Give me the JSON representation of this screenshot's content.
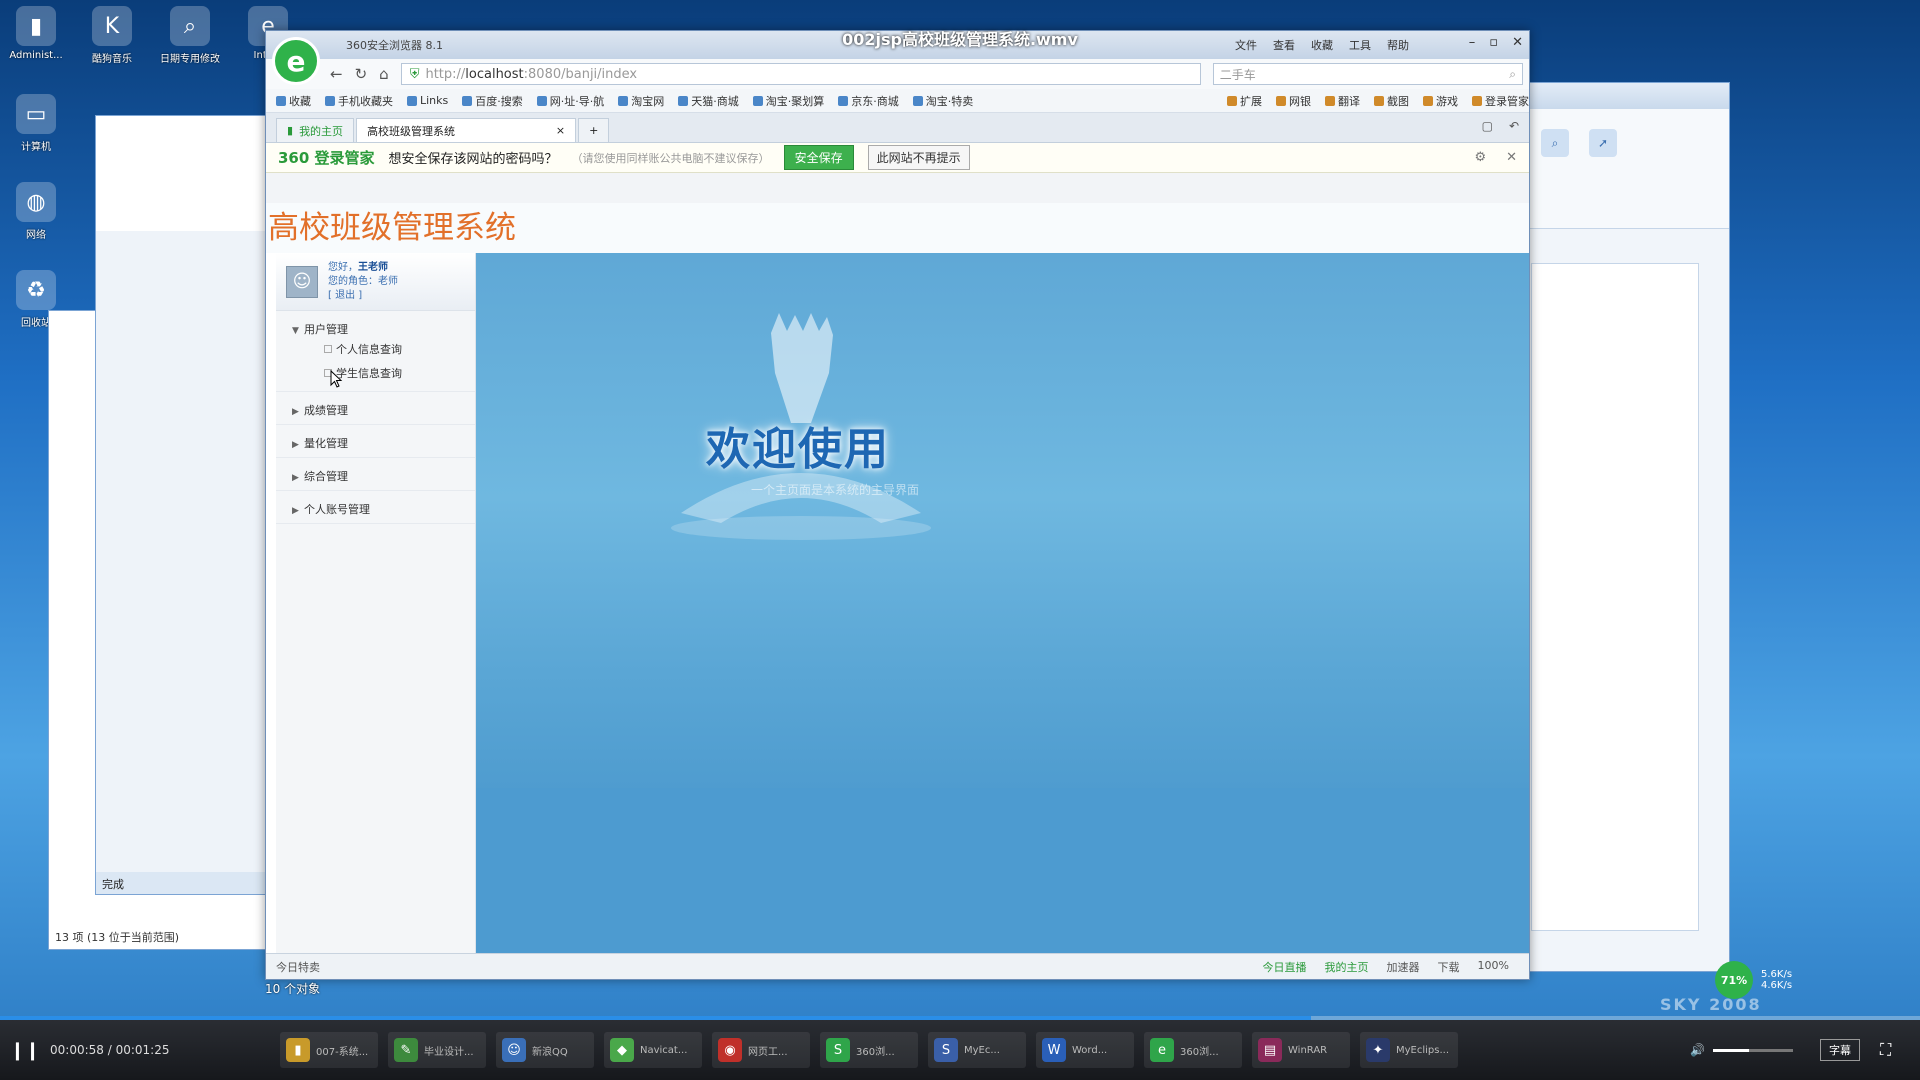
{
  "video": {
    "title": "002jsp高校班级管理系统.wmv",
    "current_time": "00:00:58",
    "total_time": "00:01:25",
    "time_separator": " / ",
    "progress": 0.683,
    "volume": 0.45,
    "subtitle_button": "字幕"
  },
  "desktop": {
    "left_icons": [
      {
        "label": "Administ...",
        "icon": "folder-user-icon",
        "glyph": "▮"
      },
      {
        "label": "计算机",
        "icon": "computer-icon",
        "glyph": "▭"
      },
      {
        "label": "网络",
        "icon": "network-icon",
        "glyph": "◍"
      },
      {
        "label": "回收站",
        "icon": "recycle-bin-icon",
        "glyph": "♻"
      }
    ],
    "top_icons": [
      {
        "label": "酷狗音乐",
        "icon": "kugou-icon",
        "glyph": "K"
      },
      {
        "label": "日期专用修改工具1.exe",
        "icon": "search-tool-icon",
        "glyph": "⌕"
      },
      {
        "label": "Inte...",
        "icon": "ie-icon",
        "glyph": "e"
      }
    ]
  },
  "browser": {
    "titlebar": "360安全浏览器 8.1",
    "menus": [
      "文件",
      "查看",
      "收藏",
      "工具",
      "帮助"
    ],
    "url_prefix": "http://",
    "url_host": "localhost",
    "url_rest": ":8080/banji/index",
    "search_placeholder": "二手车",
    "favorites": [
      "收藏",
      "手机收藏夹",
      "Links",
      "百度·搜索",
      "网·址·导·航",
      "淘宝网",
      "天猫·商城",
      "淘宝·聚划算",
      "京东·商城",
      "淘宝·特卖"
    ],
    "fav_right": [
      "扩展",
      "网银",
      "翻译",
      "截图",
      "游戏",
      "登录管家"
    ],
    "tabs": [
      {
        "label": "我的主页"
      },
      {
        "label": "高校班级管理系统"
      }
    ],
    "password_bar": {
      "brand": "360 登录管家",
      "question": "想安全保存该网站的密码吗？",
      "hint": "（请您使用同样账公共电脑不建议保存）",
      "save": "安全保存",
      "never": "此网站不再提示"
    },
    "status": {
      "left": "今日特卖",
      "items": [
        "今日直播",
        "我的主页",
        "加速器",
        "下载",
        "100%"
      ]
    }
  },
  "app": {
    "title": "高校班级管理系统",
    "user": {
      "welcome_prefix": "您好，",
      "name": "王老师",
      "role_prefix": "您的角色：",
      "role": "老师",
      "logout": "[ 退出 ]"
    },
    "menu": [
      {
        "label": "用户管理",
        "expanded": true,
        "children": [
          "个人信息查询",
          "学生信息查询"
        ]
      },
      {
        "label": "成绩管理",
        "expanded": false,
        "children": []
      },
      {
        "label": "量化管理",
        "expanded": false,
        "children": []
      },
      {
        "label": "综合管理",
        "expanded": false,
        "children": []
      },
      {
        "label": "个人账号管理",
        "expanded": false,
        "children": []
      }
    ],
    "welcome_text": "欢迎使用",
    "welcome_sub": "一个主页面是本系统的主导界面"
  },
  "misc": {
    "object_count": "10 个对象",
    "explorer_status": "13 项 (13 位于当前范围)",
    "left_window_status": "完成",
    "net_percent": "71%",
    "net_up": "5.6K/s",
    "net_down": "4.6K/s",
    "sky_text": "SKY 2008"
  },
  "taskbar": [
    {
      "label": "007-系统...",
      "color": "#c89a2a",
      "glyph": "▮"
    },
    {
      "label": "毕业设计...",
      "color": "#3d8a3d",
      "glyph": "✎"
    },
    {
      "label": "新浪QQ",
      "color": "#3a6fb8",
      "glyph": "☺"
    },
    {
      "label": "Navicat...",
      "color": "#4aa84a",
      "glyph": "◆"
    },
    {
      "label": "网页工...",
      "color": "#c0302a",
      "glyph": "◉"
    },
    {
      "label": "360浏...",
      "color": "#2fa54a",
      "glyph": "S"
    },
    {
      "label": "MyEc...",
      "color": "#3a5fa8",
      "glyph": "S"
    },
    {
      "label": "Word...",
      "color": "#2a5fb8",
      "glyph": "W"
    },
    {
      "label": "360浏...",
      "color": "#2fa54a",
      "glyph": "e"
    },
    {
      "label": "WinRAR",
      "color": "#8a2a5a",
      "glyph": "▤"
    },
    {
      "label": "MyEclips...",
      "color": "#2a3a6a",
      "glyph": "✦"
    }
  ],
  "colors": {
    "title_orange": "#e2702a",
    "welcome_blue": "#1e67b3",
    "save_green": "#3db04d",
    "progress_blue": "#2a8ee8"
  }
}
